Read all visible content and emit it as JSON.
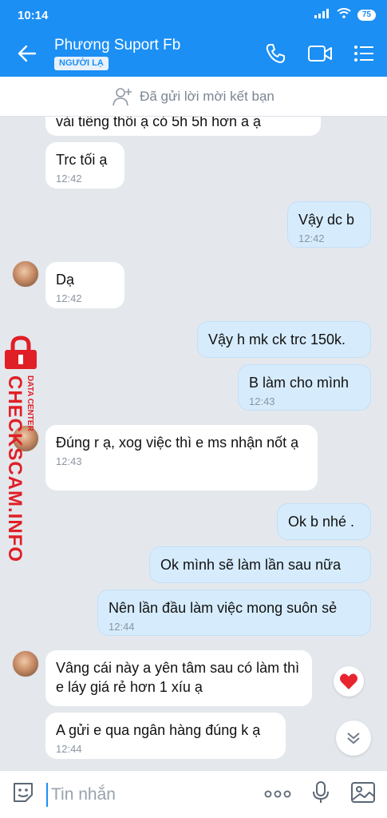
{
  "status": {
    "time": "10:14",
    "battery": "75"
  },
  "header": {
    "title": "Phương Suport Fb",
    "badge": "NGƯỜI LẠ"
  },
  "friend_notice": "Đã gửi lời mời kết bạn",
  "messages": [
    {
      "text": "vài tiếng thôi ạ có 5h 5h hơn a ạ",
      "time": ""
    },
    {
      "text": "Trc tối ạ",
      "time": "12:42"
    },
    {
      "text": "Vậy dc b",
      "time": "12:42"
    },
    {
      "text": "Dạ",
      "time": "12:42"
    },
    {
      "text": "Vậy h mk ck trc 150k.",
      "time": ""
    },
    {
      "text": "B làm cho mình",
      "time": "12:43"
    },
    {
      "text": "Đúng r ạ, xog việc thì e ms nhận nốt ạ",
      "time": "12:43"
    },
    {
      "text": "Ok b nhé .",
      "time": ""
    },
    {
      "text": "Ok mình sẽ làm lần sau nữa",
      "time": ""
    },
    {
      "text": "Nên lần đầu làm việc mong suôn sẻ",
      "time": "12:44"
    },
    {
      "text": "Vâng cái này a yên tâm sau có làm thì e láy giá rẻ hơn 1 xíu ạ",
      "time": ""
    },
    {
      "text": "A gửi e qua ngân hàng đúng k ạ",
      "time": "12:44"
    }
  ],
  "composer": {
    "placeholder": "Tin nhắn"
  },
  "watermark": {
    "main": "CHECKSCAM.INFO",
    "sub": "DATA CENTER"
  },
  "colors": {
    "primary": "#1b8ff4",
    "outgoing_bubble": "#d6ecfd",
    "incoming_bubble": "#ffffff",
    "watermark": "#e01f26"
  },
  "icons": [
    "back-arrow-icon",
    "phone-icon",
    "video-call-icon",
    "menu-icon",
    "add-friend-icon",
    "heart-icon",
    "chevron-double-down-icon",
    "sticker-icon",
    "more-icon",
    "microphone-icon",
    "image-icon"
  ]
}
